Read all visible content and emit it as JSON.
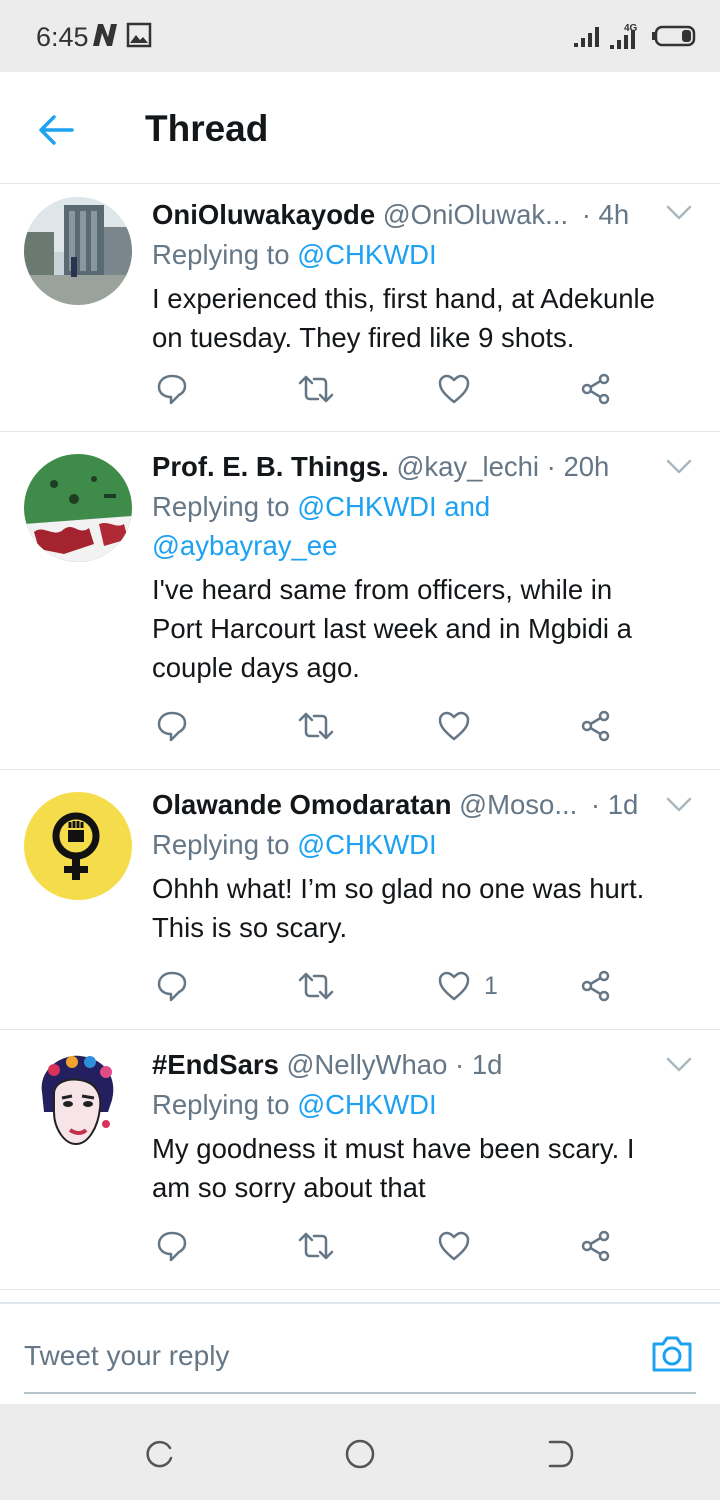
{
  "status_bar": {
    "time": "6:45",
    "network": "4G"
  },
  "header": {
    "title": "Thread"
  },
  "tweets": [
    {
      "name": "OniOluwakayode",
      "handle": "@OniOluwak...",
      "time": "· 4h",
      "replying_prefix": "Replying to",
      "replying_to": "@CHKWDI",
      "text_lines": [
        "I experienced this, first hand, at Adekunle",
        "on tuesday. They fired like 9 shots."
      ],
      "like_count": ""
    },
    {
      "name": "Prof. E. B. Things.",
      "handle": "@kay_lechi",
      "time": "· 20h",
      "replying_prefix": "Replying to",
      "replying_to": "@CHKWDI and",
      "replying_to_2": "@aybayray_ee",
      "text_lines": [
        "I've heard same from officers, while in",
        "Port Harcourt last week and in Mgbidi a",
        "couple days ago."
      ],
      "like_count": ""
    },
    {
      "name": "Olawande Omodaratan",
      "handle": "@Moso...",
      "time": "· 1d",
      "replying_prefix": "Replying to",
      "replying_to": "@CHKWDI",
      "text_lines": [
        "Ohhh what! I’m so glad no one was hurt.",
        "This is so scary."
      ],
      "like_count": "1"
    },
    {
      "name": "#EndSars",
      "handle": "@NellyWhao",
      "time": "· 1d",
      "replying_prefix": "Replying to",
      "replying_to": "@CHKWDI",
      "text_lines": [
        "My goodness it must have been scary. I",
        "am so sorry about that"
      ],
      "like_count": ""
    }
  ],
  "reply_bar": {
    "placeholder": "Tweet your reply"
  },
  "colors": {
    "accent": "#1da1f2",
    "secondary_text": "#657786",
    "primary_text": "#14171a"
  }
}
